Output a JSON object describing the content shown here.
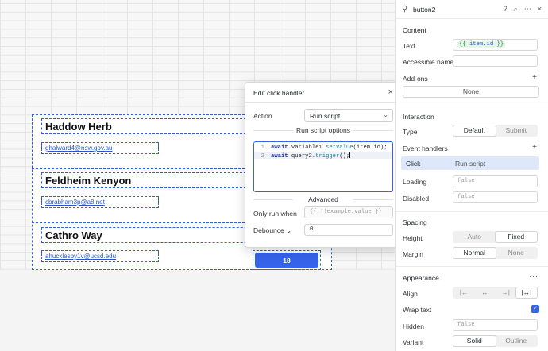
{
  "canvas": {
    "cards": [
      {
        "name": "Haddow Herb",
        "email": "ghalward4@nsw.gov.au"
      },
      {
        "name": "Feldheim Kenyon",
        "email": "cbrabham3p@a8.net"
      },
      {
        "name": "Cathro Way",
        "email": "ahucklesby1v@ucsd.edu"
      }
    ],
    "button_value": "18"
  },
  "modal": {
    "title": "Edit click handler",
    "close_icon": "×",
    "action_label": "Action",
    "action_value": "Run script",
    "options_heading": "Run script options",
    "code": {
      "line1_num": "1",
      "line1_kw": "await",
      "line1_obj": " variable1.",
      "line1_fn": "setValue",
      "line1_rest": "(item.id);",
      "line2_num": "2",
      "line2_kw": "await",
      "line2_obj": " query2.",
      "line2_fn": "trigger",
      "line2_rest": "();"
    },
    "advanced_heading": "Advanced",
    "only_run_when_label": "Only run when",
    "only_run_when_placeholder": "{{ !!example.value }}",
    "debounce_label": "Debounce",
    "debounce_value": "0"
  },
  "inspector": {
    "component_name": "button2",
    "header_icons": [
      "?",
      "⌕",
      "⋯",
      "×"
    ],
    "content": {
      "title": "Content",
      "text_label": "Text",
      "text_value_open": "{{ ",
      "text_value_id": "item.id",
      "text_value_close": " }}",
      "accessible_name_label": "Accessible name",
      "addons_label": "Add-ons",
      "addons_value": "None"
    },
    "interaction": {
      "title": "Interaction",
      "type_label": "Type",
      "type_options": [
        "Default",
        "Submit"
      ],
      "event_handlers_label": "Event handlers",
      "handler_event": "Click",
      "handler_action": "Run script",
      "loading_label": "Loading",
      "loading_value": "false",
      "disabled_label": "Disabled",
      "disabled_value": "false"
    },
    "spacing": {
      "title": "Spacing",
      "height_label": "Height",
      "height_options": [
        "Auto",
        "Fixed"
      ],
      "margin_label": "Margin",
      "margin_options": [
        "Normal",
        "None"
      ]
    },
    "appearance": {
      "title": "Appearance",
      "align_label": "Align",
      "wrap_text_label": "Wrap text",
      "hidden_label": "Hidden",
      "hidden_value": "false",
      "variant_label": "Variant",
      "variant_options": [
        "Solid",
        "Outline"
      ]
    }
  },
  "colors": {
    "accent": "#3563e9",
    "selection_dash": "#2f5fe0",
    "handler_highlight": "#dde8fb"
  }
}
